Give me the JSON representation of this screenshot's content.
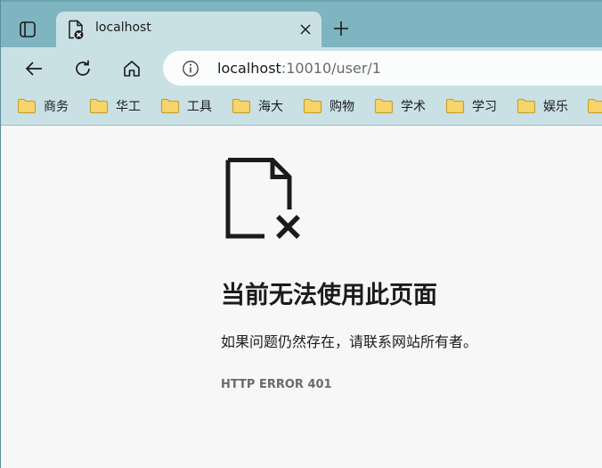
{
  "browser": {
    "tab_title": "localhost",
    "url_host": "localhost",
    "url_path": ":10010/user/1",
    "new_tab_label": "+"
  },
  "bookmarks": [
    {
      "label": "商务"
    },
    {
      "label": "华工"
    },
    {
      "label": "工具"
    },
    {
      "label": "海大"
    },
    {
      "label": "购物"
    },
    {
      "label": "学术"
    },
    {
      "label": "学习"
    },
    {
      "label": "娱乐"
    }
  ],
  "error_page": {
    "heading": "当前无法使用此页面",
    "description": "如果问题仍然存在，请联系网站所有者。",
    "code": "HTTP ERROR 401"
  },
  "colors": {
    "tab_strip": "#7eb5c0",
    "toolbar": "#c9e1e5",
    "folder_fill": "#f6d66b",
    "folder_stroke": "#c9a235"
  },
  "icons": {
    "tab_actions": "tab-actions-icon",
    "favicon": "error-page-favicon",
    "close": "close-icon",
    "back": "back-arrow-icon",
    "refresh": "refresh-icon",
    "home": "home-icon",
    "info": "info-icon",
    "folder": "folder-icon",
    "error_document": "broken-document-icon"
  }
}
